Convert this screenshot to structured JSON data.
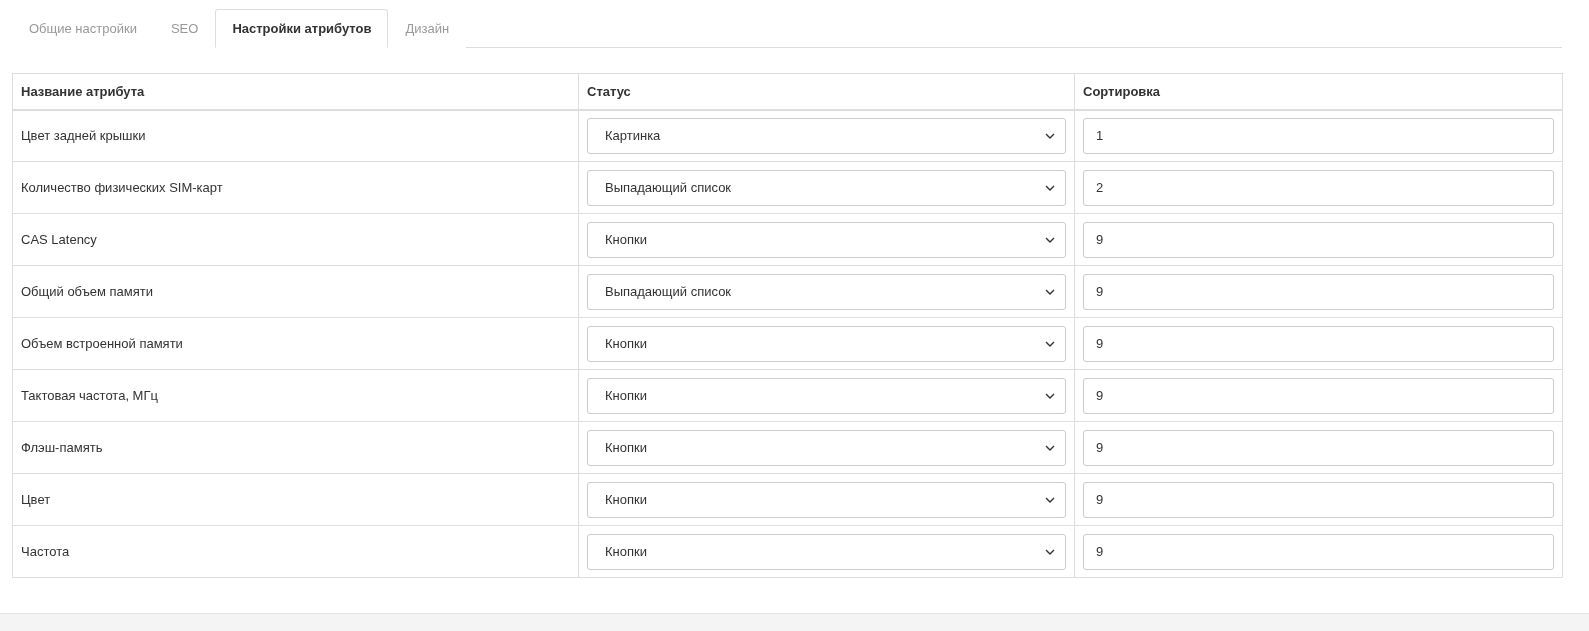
{
  "tabs": [
    {
      "label": "Общие настройки",
      "selected": false
    },
    {
      "label": "SEO",
      "selected": false
    },
    {
      "label": "Настройки атрибутов",
      "selected": true
    },
    {
      "label": "Дизайн",
      "selected": false
    }
  ],
  "table": {
    "columns": [
      "Название атрибута",
      "Статус",
      "Сортировка"
    ],
    "rows": [
      {
        "name": "Цвет задней крышки",
        "status": "Картинка",
        "sort": "1"
      },
      {
        "name": "Количество физических SIM-карт",
        "status": "Выпадающий список",
        "sort": "2"
      },
      {
        "name": "CAS Latency",
        "status": "Кнопки",
        "sort": "9"
      },
      {
        "name": "Общий объем памяти",
        "status": "Выпадающий список",
        "sort": "9"
      },
      {
        "name": "Объем встроенной памяти",
        "status": "Кнопки",
        "sort": "9"
      },
      {
        "name": "Тактовая частота, МГц",
        "status": "Кнопки",
        "sort": "9"
      },
      {
        "name": "Флэш-память",
        "status": "Кнопки",
        "sort": "9"
      },
      {
        "name": "Цвет",
        "status": "Кнопки",
        "sort": "9"
      },
      {
        "name": "Частота",
        "status": "Кнопки",
        "sort": "9"
      }
    ]
  }
}
